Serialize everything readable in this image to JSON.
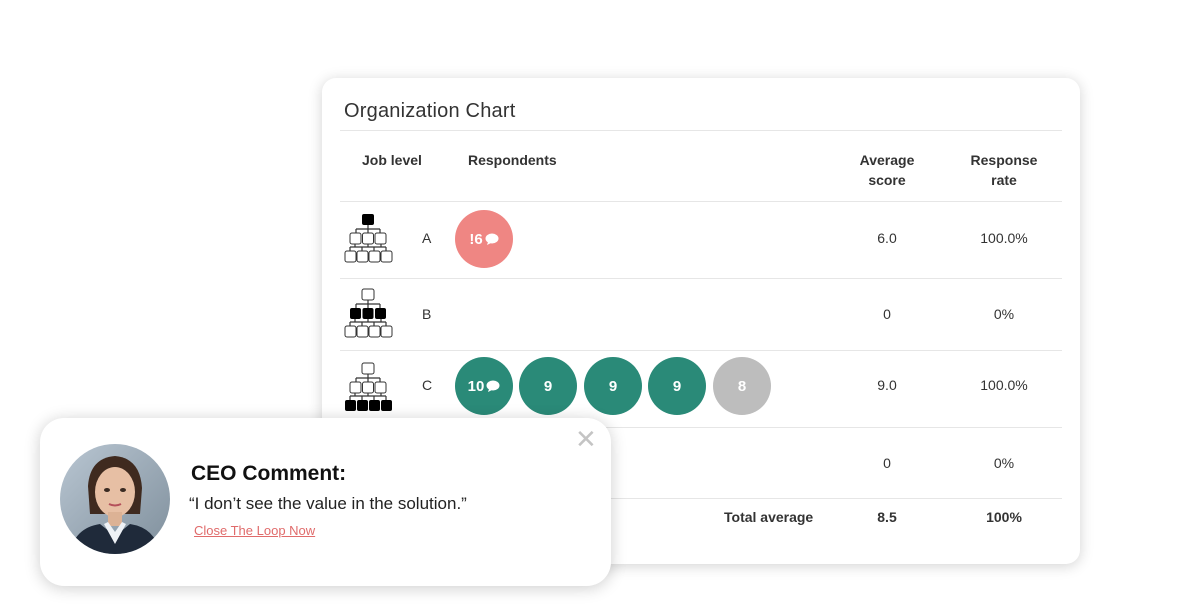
{
  "card": {
    "title": "Organization Chart",
    "headers": {
      "job_level": "Job level",
      "respondents": "Respondents",
      "average_score_l1": "Average",
      "average_score_l2": "score",
      "response_rate_l1": "Response",
      "response_rate_l2": "rate"
    },
    "rows": [
      {
        "level": "A",
        "org_icon": "org-chart-top-highlighted-icon",
        "respondents": [
          {
            "label": "!6",
            "color": "red",
            "comment": true
          }
        ],
        "average": "6.0",
        "rate": "100.0%"
      },
      {
        "level": "B",
        "org_icon": "org-chart-middle-highlighted-icon",
        "respondents": [],
        "average": "0",
        "rate": "0%"
      },
      {
        "level": "C",
        "org_icon": "org-chart-bottom-highlighted-icon",
        "respondents": [
          {
            "label": "10",
            "color": "green",
            "comment": true
          },
          {
            "label": "9",
            "color": "green",
            "comment": false
          },
          {
            "label": "9",
            "color": "green",
            "comment": false
          },
          {
            "label": "9",
            "color": "green",
            "comment": false
          },
          {
            "label": "8",
            "color": "grey",
            "comment": false
          }
        ],
        "average": "9.0",
        "rate": "100.0%"
      },
      {
        "level": "",
        "respondents": [],
        "average": "0",
        "rate": "0%"
      }
    ],
    "total": {
      "label": "Total average",
      "average": "8.5",
      "rate": "100%"
    }
  },
  "popup": {
    "title": "CEO Comment:",
    "quote": "“I don’t see the value in the solution.”",
    "link": "Close The Loop Now",
    "close_icon": "close-icon"
  },
  "colors": {
    "red_bubble": "#ef8683",
    "green_bubble": "#2a8a78",
    "grey_bubble": "#bdbdbd",
    "link": "#e06b6b"
  }
}
